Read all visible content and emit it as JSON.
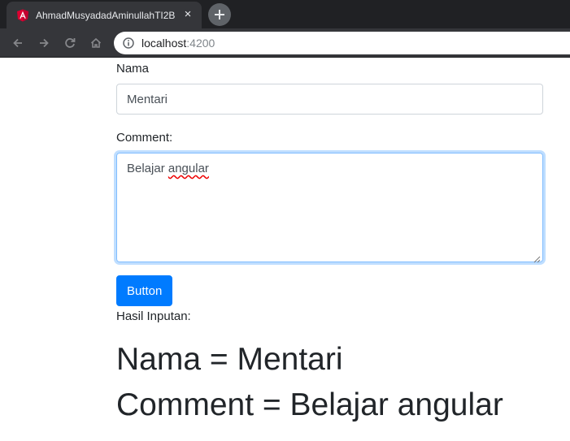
{
  "browser": {
    "tab_title": "AhmadMusyadadAminullahTI2B",
    "tab_close": "×",
    "favicon": "angular-icon",
    "url_host": "localhost",
    "url_port": ":4200"
  },
  "form": {
    "nama_label": "Nama",
    "nama_value": "Mentari",
    "comment_label": "Comment:",
    "comment_value_word1": "Belajar",
    "comment_value_word2": "angular",
    "button_label": "Button",
    "hasil_label": "Hasil Inputan:"
  },
  "result": {
    "nama_line": "Nama = Mentari",
    "comment_line": "Comment = Belajar angular"
  },
  "colors": {
    "primary": "#007bff",
    "focus_border": "#80bdff",
    "chrome_dark": "#202124",
    "chrome_tab": "#35363a",
    "angular_red": "#dd0031"
  }
}
